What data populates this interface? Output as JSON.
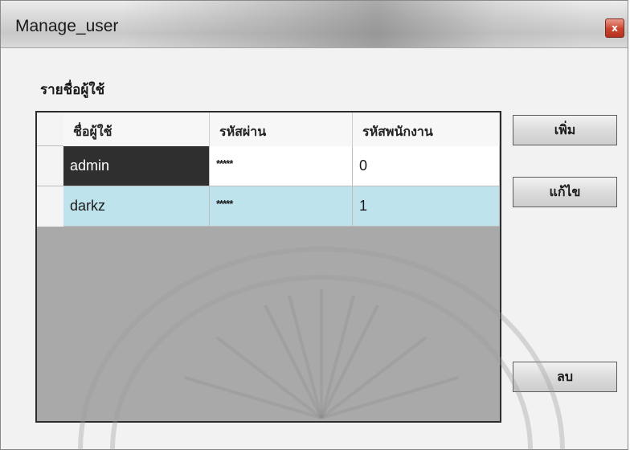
{
  "window": {
    "title": "Manage_user",
    "close_label": "x"
  },
  "list_label": "รายชื่อผู้ใช้",
  "table": {
    "columns": [
      "ชื่อผู้ใช้",
      "รหัสผ่าน",
      "รหัสพนักงาน"
    ],
    "rows": [
      [
        "admin",
        "*****",
        "0"
      ],
      [
        "darkz",
        "*****",
        "1"
      ]
    ]
  },
  "buttons": {
    "add": "เพิ่ม",
    "edit": "แก้ไข",
    "delete": "ลบ"
  },
  "colors": {
    "selected_row": "#2f2f2f",
    "highlight_row": "#bfe3ec",
    "grid_background": "#a9a9a9"
  }
}
